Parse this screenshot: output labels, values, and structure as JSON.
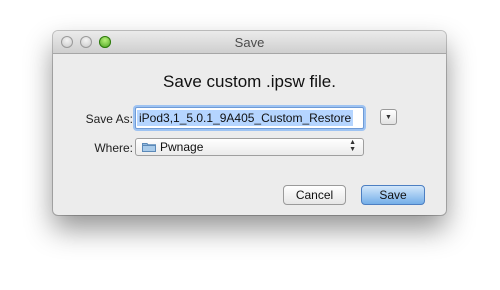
{
  "window": {
    "title": "Save"
  },
  "dialog": {
    "heading": "Save custom .ipsw file.",
    "save_as_label": "Save As:",
    "filename_value": "iPod3,1_5.0.1_9A405_Custom_Restore",
    "where_label": "Where:",
    "where_value": "Pwnage",
    "cancel_label": "Cancel",
    "save_label": "Save"
  },
  "icons": {
    "expand": "disclosure-triangle-icon",
    "folder": "folder-icon",
    "updown": "up-down-arrows-icon"
  },
  "colors": {
    "default_button": "#74aee8",
    "selection": "#b5d5ff",
    "zoom_button": "#3e9a16"
  }
}
